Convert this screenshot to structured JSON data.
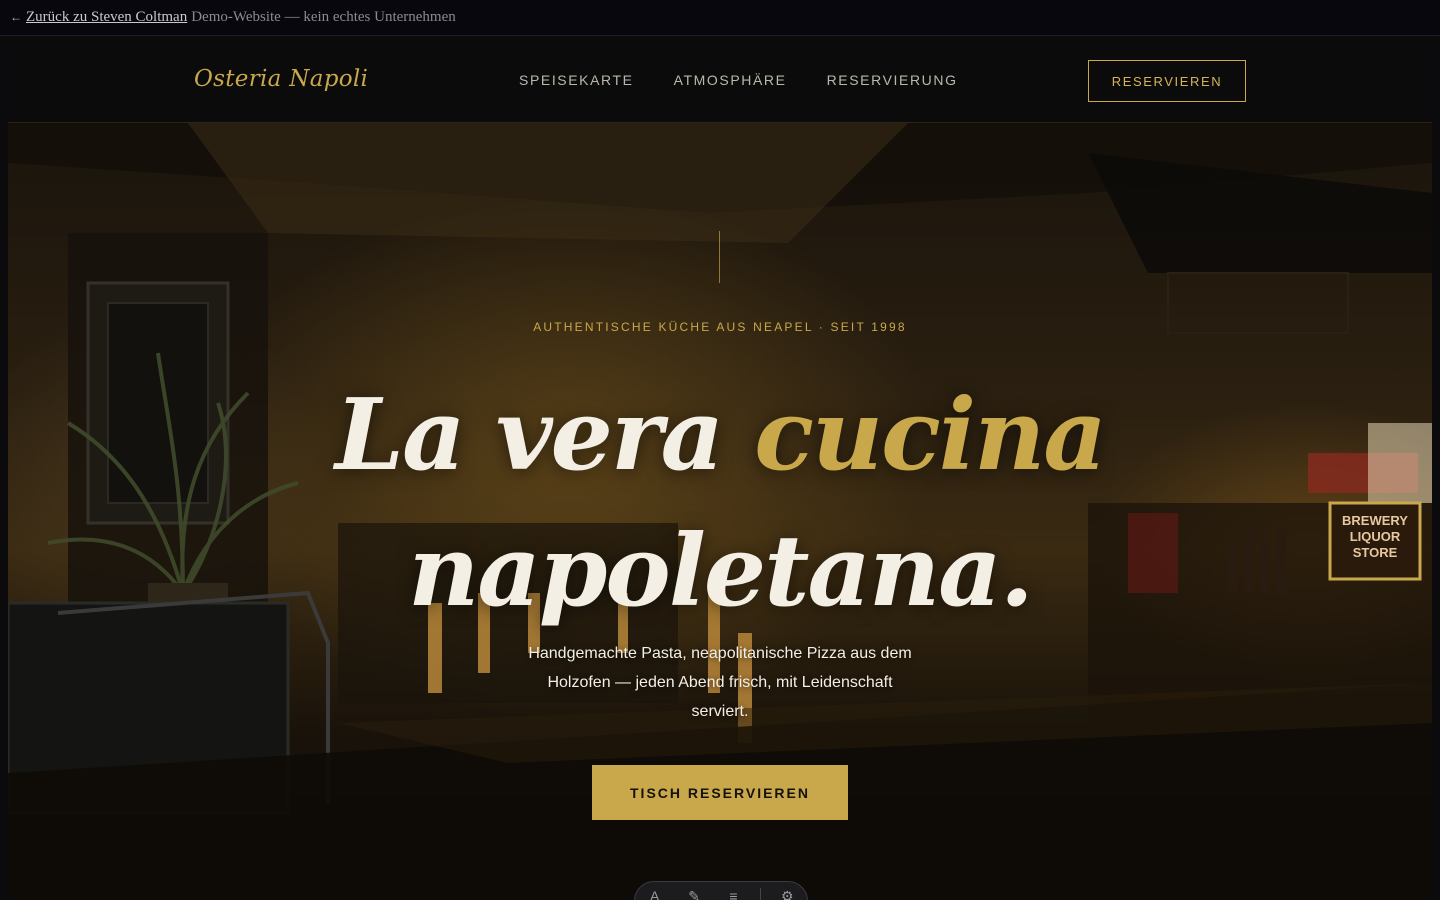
{
  "demo_banner": {
    "back_link": "Zurück zu Steven Coltman",
    "note": "Demo-Website — kein echtes Unternehmen"
  },
  "nav": {
    "logo": "Osteria Napoli",
    "links": [
      "SPEISEKARTE",
      "ATMOSPHÄRE",
      "RESERVIERUNG"
    ],
    "cta": "RESERVIEREN"
  },
  "hero": {
    "eyebrow": "AUTHENTISCHE KÜCHE AUS NEAPEL · SEIT 1998",
    "headline_part1": "La vera ",
    "headline_accent": "cucina",
    "headline_part2": "napoletana.",
    "subtext": "Handgemachte Pasta, neapolitanische Pizza aus dem Holzofen — jeden Abend frisch, mit Leidenschaft serviert.",
    "cta": "TISCH RESERVIEREN"
  },
  "colors": {
    "accent": "#c9a84c",
    "background": "#0b0b0b",
    "text": "#f4efe4"
  }
}
